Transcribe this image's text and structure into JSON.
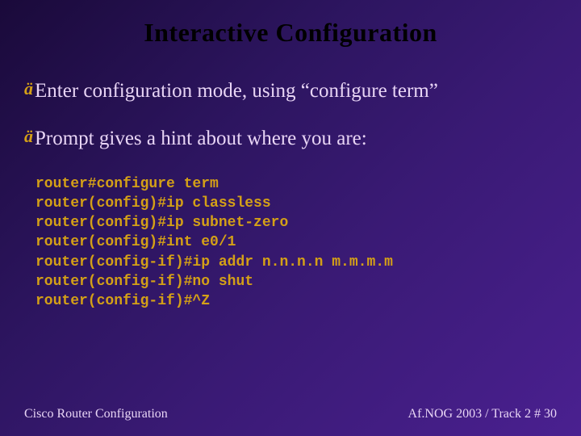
{
  "title": "Interactive Configuration",
  "bullets": [
    "Enter configuration mode, using “configure term”",
    "Prompt gives a hint about where you are:"
  ],
  "code": "router#configure term\nrouter(config)#ip classless\nrouter(config)#ip subnet-zero\nrouter(config)#int e0/1\nrouter(config-if)#ip addr n.n.n.n m.m.m.m\nrouter(config-if)#no shut\nrouter(config-if)#^Z",
  "footer": {
    "left": "Cisco Router Configuration",
    "right": "Af.NOG 2003 / Track 2  # 30"
  }
}
